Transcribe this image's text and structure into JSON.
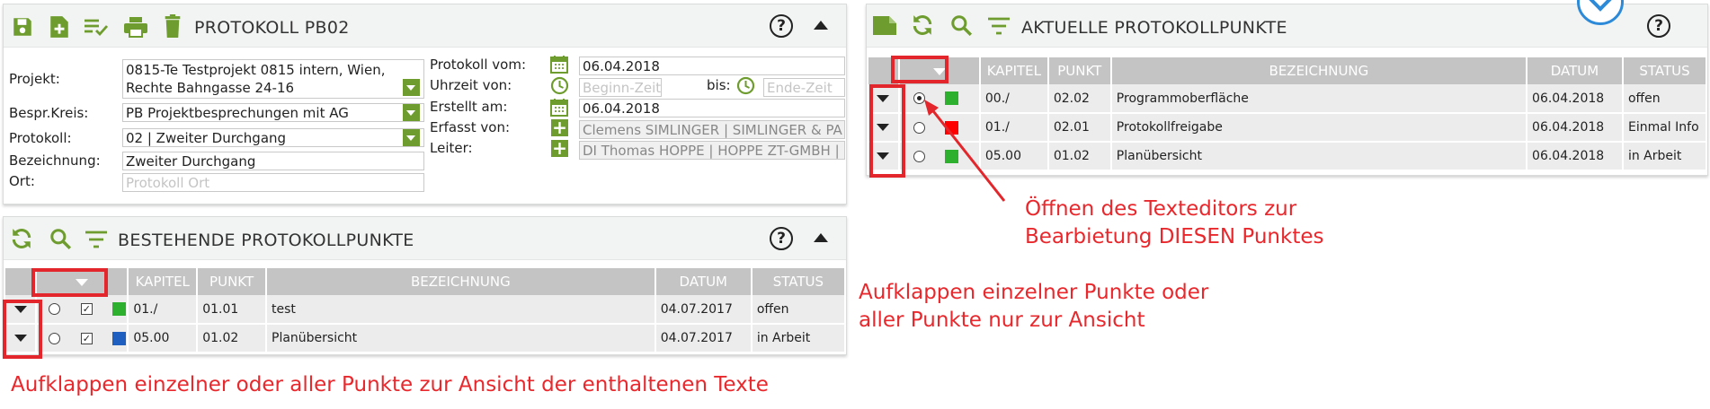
{
  "colors": {
    "accent_green": "#6e9c2e",
    "annotation_red": "#e8282c",
    "status_green": "#2db02d",
    "status_red": "#ff0000",
    "status_blue": "#1f5fbf"
  },
  "protokoll": {
    "title": "PROTOKOLL PB02",
    "icons": [
      "save-icon",
      "add-document-icon",
      "checklist-icon",
      "print-icon",
      "trash-icon"
    ],
    "labels": {
      "projekt": "Projekt:",
      "kreis": "Bespr.Kreis:",
      "protokoll": "Protokoll:",
      "bezeichnung": "Bezeichnung:",
      "ort": "Ort:",
      "protokoll_vom": "Protokoll vom:",
      "uhrzeit": "Uhrzeit von:",
      "bis": "bis:",
      "erstellt": "Erstellt am:",
      "erfasst": "Erfasst von:",
      "leiter": "Leiter:"
    },
    "values": {
      "projekt_line1": "0815-Te Testprojekt 0815 intern, Wien,",
      "projekt_line2": "Rechte Bahngasse 24-16",
      "kreis": "PB Projektbesprechungen mit AG",
      "protokoll": "02 | Zweiter Durchgang",
      "bezeichnung": "Zweiter Durchgang",
      "protokoll_vom": "06.04.2018",
      "erstellt": "06.04.2018",
      "erfasst": "Clemens SIMLINGER | SIMLINGER & PA",
      "leiter": "DI Thomas HOPPE | HOPPE ZT-GMBH |"
    },
    "placeholders": {
      "ort": "Protokoll Ort",
      "beginn": "Beginn-Zeit",
      "ende": "Ende-Zeit"
    }
  },
  "bestehende": {
    "title": "BESTEHENDE PROTOKOLLPUNKTE",
    "columns": [
      "KAPITEL",
      "PUNKT",
      "BEZEICHNUNG",
      "DATUM",
      "STATUS"
    ],
    "rows": [
      {
        "kapitel": "01./",
        "punkt": "01.01",
        "bezeichnung": "test",
        "datum": "04.07.2017",
        "status": "offen",
        "color": "#2db02d"
      },
      {
        "kapitel": "05.00",
        "punkt": "01.02",
        "bezeichnung": "Planübersicht",
        "datum": "04.07.2017",
        "status": "in Arbeit",
        "color": "#1f5fbf"
      }
    ]
  },
  "aktuelle": {
    "title": "AKTUELLE PROTOKOLLPUNKTE",
    "columns": [
      "KAPITEL",
      "PUNKT",
      "BEZEICHNUNG",
      "DATUM",
      "STATUS"
    ],
    "rows": [
      {
        "kapitel": "00./",
        "punkt": "02.02",
        "bezeichnung": "Programmoberfläche",
        "datum": "06.04.2018",
        "status": "offen",
        "color": "#2db02d"
      },
      {
        "kapitel": "01./",
        "punkt": "02.01",
        "bezeichnung": "Protokollfreigabe",
        "datum": "06.04.2018",
        "status": "Einmal Info",
        "color": "#ff0000"
      },
      {
        "kapitel": "05.00",
        "punkt": "01.02",
        "bezeichnung": "Planübersicht",
        "datum": "06.04.2018",
        "status": "in Arbeit",
        "color": "#2db02d"
      }
    ]
  },
  "annotations": {
    "texteditor_line1": "Öffnen des Texteditors zur",
    "texteditor_line2": "Bearbietung DIESEN Punktes",
    "aufklappen_line1": "Aufklappen einzelner Punkte oder",
    "aufklappen_line2": "aller Punkte nur zur Ansicht",
    "bottom": "Aufklappen einzelner oder aller Punkte zur Ansicht der enthaltenen Texte"
  }
}
